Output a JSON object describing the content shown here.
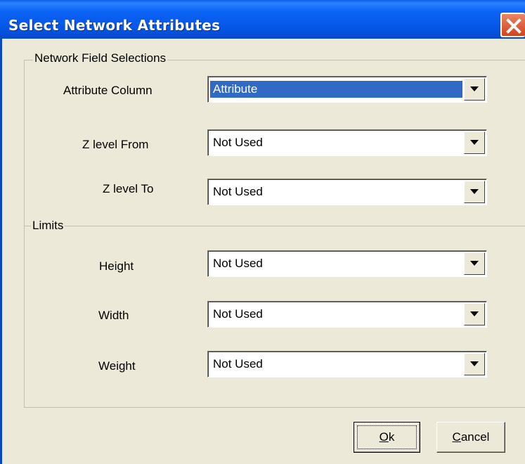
{
  "window": {
    "title": "Select Network Attributes"
  },
  "field_group": {
    "legend": "Network Field Selections",
    "rows": [
      {
        "label": "Attribute Column",
        "value": "Attribute",
        "selected": true
      },
      {
        "label": "Z level From",
        "value": "Not Used"
      },
      {
        "label": "Z level To",
        "value": "Not Used"
      }
    ]
  },
  "limits_group": {
    "legend": "Limits",
    "rows": [
      {
        "label": "Height",
        "value": "Not Used"
      },
      {
        "label": "Width",
        "value": "Not Used"
      },
      {
        "label": "Weight",
        "value": "Not Used"
      }
    ]
  },
  "buttons": {
    "ok": {
      "mnemonic": "O",
      "rest": "k"
    },
    "cancel": {
      "mnemonic": "C",
      "rest": "ancel"
    }
  },
  "colors": {
    "title_bar": "#0555e5",
    "selection": "#316ac5",
    "face": "#ece9d8",
    "close": "#d2421c"
  },
  "icons": {
    "close": "close-x-icon",
    "dropdown": "dropdown-arrow-icon"
  }
}
